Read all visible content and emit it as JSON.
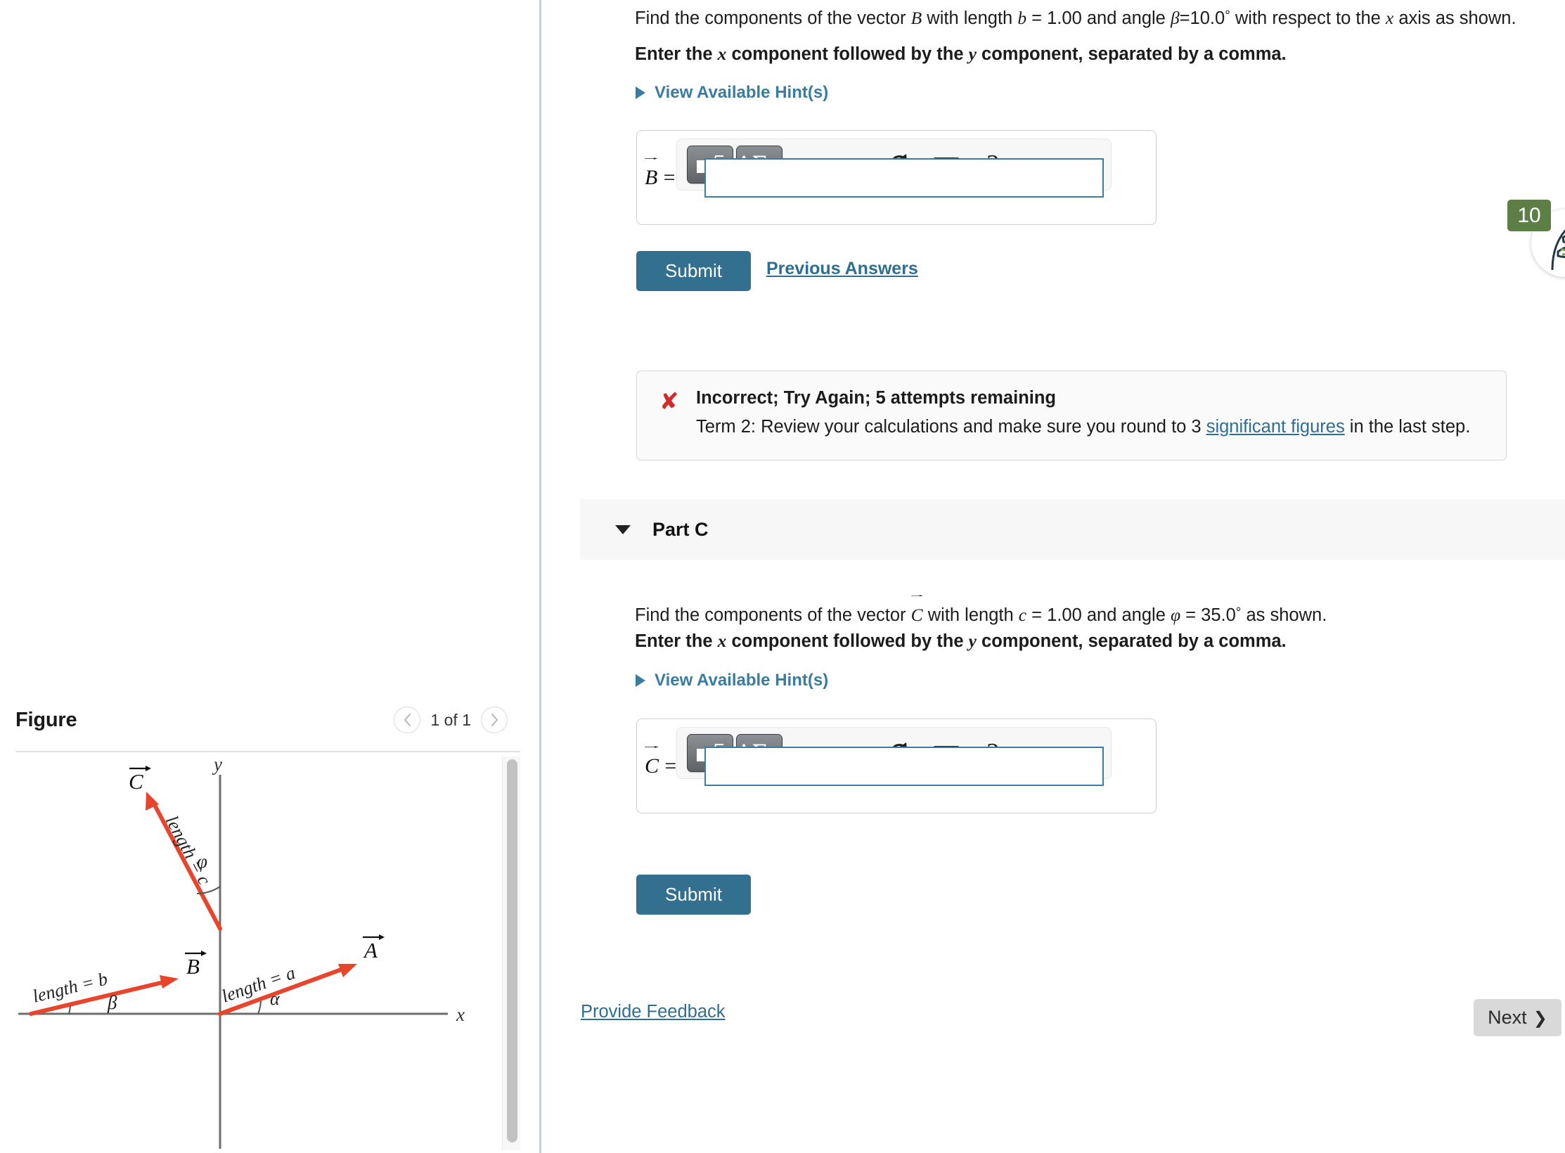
{
  "figure_panel": {
    "title": "Figure",
    "pager": {
      "prev_icon": "chevron-left-icon",
      "label": "1 of 1",
      "next_icon": "chevron-right-icon"
    },
    "diagram": {
      "axis_x_label": "x",
      "axis_y_label": "y",
      "vectors": [
        {
          "name": "A",
          "label": "A",
          "length_label": "length = a",
          "angle_label": "α",
          "angle_from": "x-axis",
          "angle_deg": 20,
          "origin": "origin",
          "color": "#e8452c"
        },
        {
          "name": "B",
          "label": "B",
          "length_label": "length = b",
          "angle_label": "β",
          "angle_from": "x-axis",
          "angle_deg": 10,
          "origin": "left of origin",
          "color": "#e8452c"
        },
        {
          "name": "C",
          "label": "C",
          "length_label": "length = c",
          "angle_label": "φ",
          "angle_from": "y-axis",
          "angle_deg": 35,
          "origin": "on y-axis above origin",
          "color": "#e8452c"
        }
      ]
    },
    "scrollbar": "vertical-scrollbar"
  },
  "part_b": {
    "question_prefix": "Find the components of the vector ",
    "vector_symbol": "B",
    "question_mid": " with length ",
    "length_var": "b",
    "length_value": " = 1.00 and angle ",
    "angle_var": "β",
    "angle_value": "=10.0",
    "degree": "°",
    "question_suffix": " with respect to the ",
    "axis_var": "x",
    "question_end": " axis as shown.",
    "instruction": "Enter the x component followed by the y component, separated by a comma.",
    "instruction_x": "x",
    "instruction_y": "y",
    "hints_label": "View Available Hint(s)",
    "answer_label": "B",
    "answer_equals": "=",
    "answer_value": "",
    "toolbar": {
      "math_template_button": "math-template-icon",
      "greek_button": "ΑΣφ",
      "undo_icon": "undo-arrow-icon",
      "redo_icon": "redo-arrow-icon",
      "reset_icon": "reset-circular-arrow-icon",
      "keyboard_icon": "keyboard-icon",
      "help_icon": "?"
    },
    "submit_label": "Submit",
    "previous_answers_label": "Previous Answers",
    "feedback": {
      "icon": "red-x-icon",
      "title": "Incorrect; Try Again; 5 attempts remaining",
      "detail_before": "Term 2: Review your calculations and make sure you round to 3 ",
      "detail_link": "significant figures",
      "detail_after": " in the last step."
    }
  },
  "part_c": {
    "caret_icon": "caret-down-icon",
    "header": "Part C",
    "question_prefix": "Find the components of the vector ",
    "vector_symbol": "C",
    "question_mid": " with length ",
    "length_var": "c",
    "length_value": " = 1.00 and angle ",
    "angle_var": "φ",
    "angle_value": " = 35.0",
    "degree": "°",
    "question_end": " as shown.",
    "instruction": "Enter the x component followed by the y component, separated by a comma.",
    "instruction_x": "x",
    "instruction_y": "y",
    "hints_label": "View Available Hint(s)",
    "answer_label": "C",
    "answer_equals": "=",
    "answer_value": "",
    "toolbar": {
      "math_template_button": "math-template-icon",
      "greek_button": "ΑΣφ",
      "undo_icon": "undo-arrow-icon",
      "redo_icon": "redo-arrow-icon",
      "reset_icon": "reset-circular-arrow-icon",
      "keyboard_icon": "keyboard-icon",
      "help_icon": "?"
    },
    "submit_label": "Submit"
  },
  "footer": {
    "provide_feedback_label": "Provide Feedback",
    "next_label": "Next",
    "next_chevron": "chevron-right-icon"
  },
  "eco_widget": {
    "count": "10",
    "icon": "tree-leaf-icon"
  },
  "colors": {
    "accent_blue": "#33708f",
    "link_blue": "#2d6e92",
    "vector_red": "#e8452c",
    "error_red": "#d22b2b",
    "badge_green": "#5d7f45",
    "divider_blue": "#c3d0e2"
  }
}
